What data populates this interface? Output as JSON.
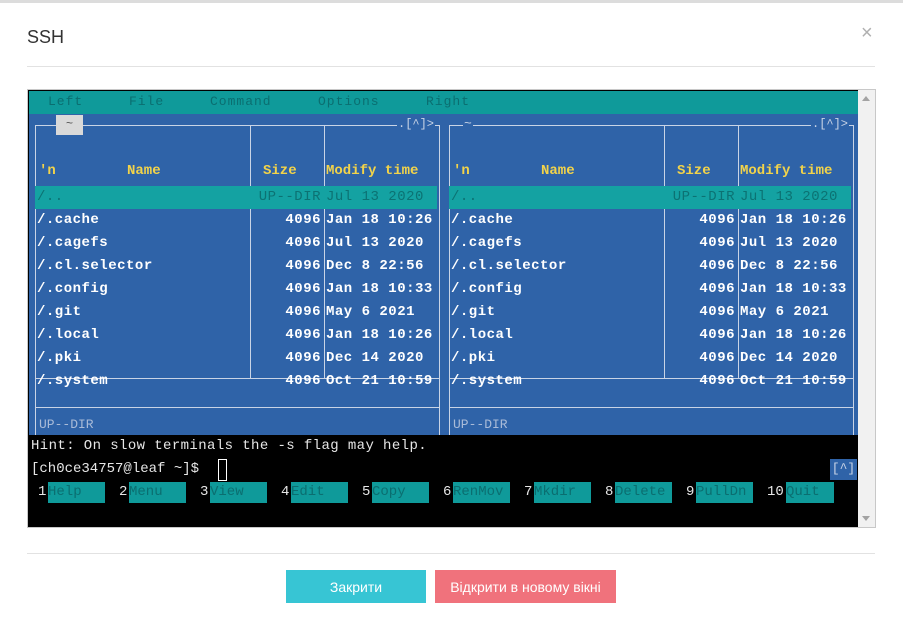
{
  "dialog": {
    "title": "SSH",
    "close_glyph": "×"
  },
  "terminal": {
    "menu": [
      "Left",
      "File",
      "Command",
      "Options",
      "Right"
    ],
    "left_panel": {
      "path": "~",
      "top_right": ".[^]>",
      "columns": {
        "n": "'n",
        "name": "Name",
        "size": "Size",
        "modify": "Modify time"
      },
      "rows": [
        {
          "name": "/..",
          "size": "UP--DIR",
          "modify": "Jul 13  2020"
        },
        {
          "name": "/.cache",
          "size": "4096",
          "modify": "Jan 18 10:26"
        },
        {
          "name": "/.cagefs",
          "size": "4096",
          "modify": "Jul 13  2020"
        },
        {
          "name": "/.cl.selector",
          "size": "4096",
          "modify": "Dec  8 22:56"
        },
        {
          "name": "/.config",
          "size": "4096",
          "modify": "Jan 18 10:33"
        },
        {
          "name": "/.git",
          "size": "4096",
          "modify": "May  6  2021"
        },
        {
          "name": "/.local",
          "size": "4096",
          "modify": "Jan 18 10:26"
        },
        {
          "name": "/.pki",
          "size": "4096",
          "modify": "Dec 14  2020"
        },
        {
          "name": "/.system",
          "size": "4096",
          "modify": "Oct 21 10:59"
        }
      ],
      "status": "UP--DIR"
    },
    "right_panel": {
      "path": "~",
      "top_right": ".[^]>",
      "columns": {
        "n": "'n",
        "name": "Name",
        "size": "Size",
        "modify": "Modify time"
      },
      "rows": [
        {
          "name": "/..",
          "size": "UP--DIR",
          "modify": "Jul 13  2020"
        },
        {
          "name": "/.cache",
          "size": "4096",
          "modify": "Jan 18 10:26"
        },
        {
          "name": "/.cagefs",
          "size": "4096",
          "modify": "Jul 13  2020"
        },
        {
          "name": "/.cl.selector",
          "size": "4096",
          "modify": "Dec  8 22:56"
        },
        {
          "name": "/.config",
          "size": "4096",
          "modify": "Jan 18 10:33"
        },
        {
          "name": "/.git",
          "size": "4096",
          "modify": "May  6  2021"
        },
        {
          "name": "/.local",
          "size": "4096",
          "modify": "Jan 18 10:26"
        },
        {
          "name": "/.pki",
          "size": "4096",
          "modify": "Dec 14  2020"
        },
        {
          "name": "/.system",
          "size": "4096",
          "modify": "Oct 21 10:59"
        }
      ],
      "status": "UP--DIR"
    },
    "hint": "Hint: On slow terminals the -s flag may help.",
    "prompt": "[ch0ce34757@leaf ~]$",
    "caret_button": "[^]",
    "fkeys": [
      {
        "num": "1",
        "label": "Help"
      },
      {
        "num": "2",
        "label": "Menu"
      },
      {
        "num": "3",
        "label": "View"
      },
      {
        "num": "4",
        "label": "Edit"
      },
      {
        "num": "5",
        "label": "Copy"
      },
      {
        "num": "6",
        "label": "RenMov"
      },
      {
        "num": "7",
        "label": "Mkdir"
      },
      {
        "num": "8",
        "label": "Delete"
      },
      {
        "num": "9",
        "label": "PullDn"
      },
      {
        "num": "10",
        "label": "Quit"
      }
    ]
  },
  "footer": {
    "close_label": "Закрити",
    "open_new_label": "Відкрити в новому вікні"
  },
  "colors": {
    "accent": "#37c5d4",
    "danger": "#f0727c",
    "panel_bg": "#2f63a8",
    "teal": "#0f9a9a",
    "header_yellow": "#f2d34a"
  }
}
